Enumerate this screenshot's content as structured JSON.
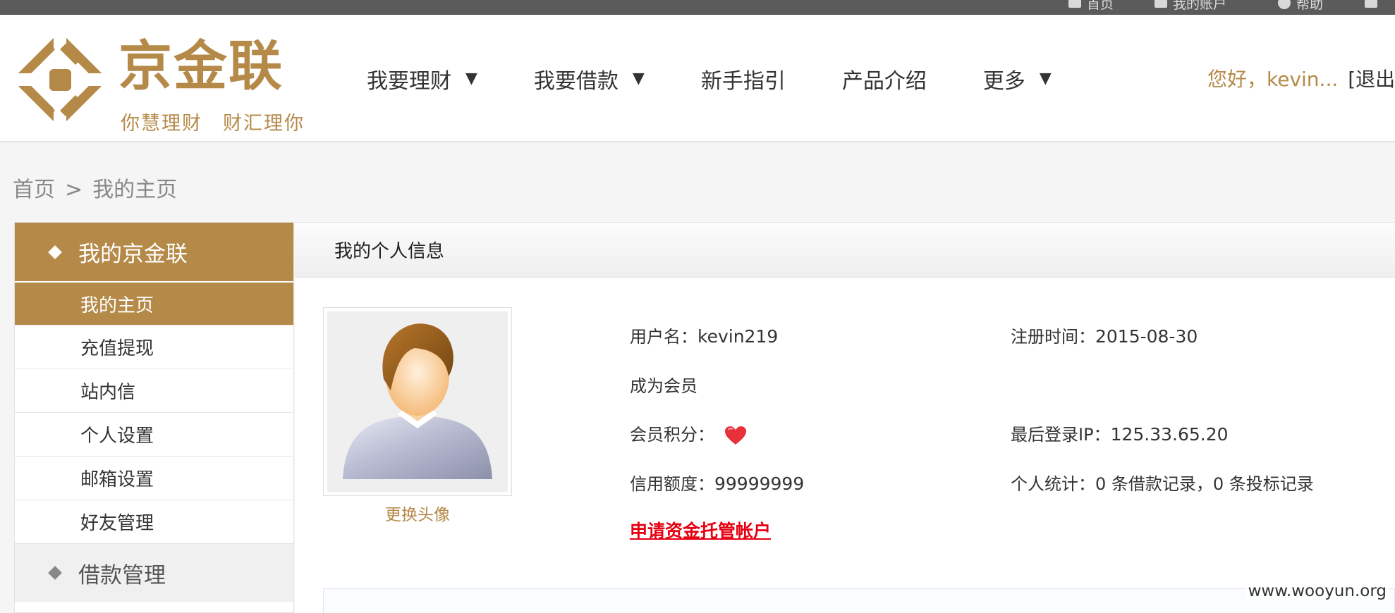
{
  "topbar": {
    "items": [
      {
        "label": "首页",
        "icon": "home-icon"
      },
      {
        "label": "我的账户",
        "icon": "account-icon"
      },
      {
        "label": "帮助",
        "icon": "help-icon"
      }
    ]
  },
  "header": {
    "brand": "京金联",
    "slogan": "你慧理财　财汇理你",
    "nav": [
      {
        "label": "我要理财",
        "dropdown": true
      },
      {
        "label": "我要借款",
        "dropdown": true
      },
      {
        "label": "新手指引",
        "dropdown": false
      },
      {
        "label": "产品介绍",
        "dropdown": false
      },
      {
        "label": "更多",
        "dropdown": true
      }
    ],
    "caret": "▼",
    "greeting": "您好，kevin...",
    "logout": "[退出]"
  },
  "breadcrumb": {
    "home": "首页",
    "separator": ">",
    "current": "我的主页"
  },
  "sidebar": {
    "section_title": "我的京金联",
    "items": [
      {
        "label": "我的主页",
        "active": true
      },
      {
        "label": "充值提现",
        "active": false
      },
      {
        "label": "站内信",
        "active": false
      },
      {
        "label": "个人设置",
        "active": false
      },
      {
        "label": "邮箱设置",
        "active": false
      },
      {
        "label": "好友管理",
        "active": false
      }
    ],
    "next_section": "借款管理"
  },
  "main": {
    "title": "我的个人信息",
    "change_avatar": "更换头像",
    "username_label": "用户名：",
    "username": "kevin219",
    "register_label": "注册时间：",
    "register_date": "2015-08-30",
    "member_label": "成为会员",
    "points_label": "会员积分：",
    "last_ip_label": "最后登录IP：",
    "last_ip": "125.33.65.20",
    "credit_label": "信用额度：",
    "credit": "99999999",
    "stats_label": "个人统计：",
    "stats": "0 条借款记录，0 条投标记录",
    "apply_link": "申请资金托管帐户"
  },
  "watermark": "www.wooyun.org",
  "colors": {
    "brand": "#b58a48",
    "link_red": "#e60012",
    "topbar": "#5b5b5b"
  }
}
